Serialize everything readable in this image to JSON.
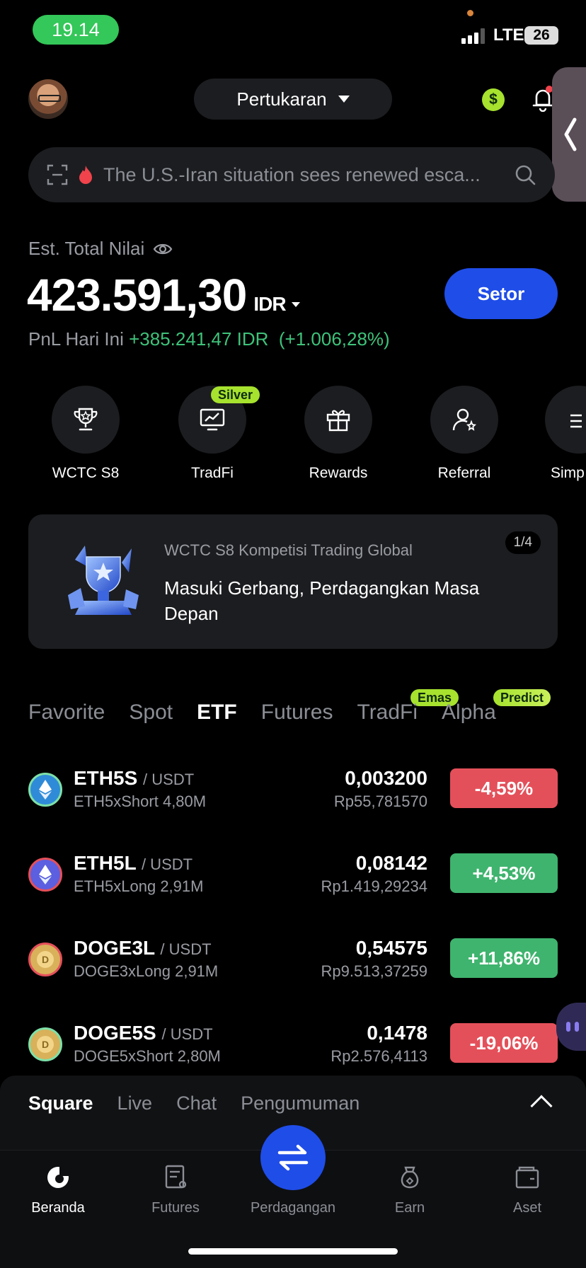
{
  "status": {
    "time": "19.14",
    "network": "LTE",
    "battery": "26"
  },
  "header": {
    "exchange_label": "Pertukaran"
  },
  "search": {
    "placeholder": "The U.S.-Iran situation sees renewed esca..."
  },
  "balance": {
    "label": "Est. Total Nilai",
    "value": "423.591,30",
    "currency": "IDR",
    "deposit_label": "Setor",
    "pnl_label": "PnL Hari Ini",
    "pnl_value": "+385.241,47 IDR",
    "pnl_pct": "(+1.006,28%)"
  },
  "quick_actions": [
    {
      "label": "WCTC S8",
      "icon": "trophy-icon"
    },
    {
      "label": "TradFi",
      "icon": "chart-screen-icon",
      "badge": "Silver"
    },
    {
      "label": "Rewards",
      "icon": "gift-icon"
    },
    {
      "label": "Referral",
      "icon": "user-plus-icon"
    },
    {
      "label": "Simp",
      "icon": "simple-earn-icon"
    }
  ],
  "banner": {
    "subtitle": "WCTC S8 Kompetisi Trading Global",
    "title": "Masuki Gerbang, Perdagangkan Masa Depan",
    "pager": "1/4"
  },
  "market_tabs": [
    {
      "label": "Favorite"
    },
    {
      "label": "Spot"
    },
    {
      "label": "ETF",
      "active": true
    },
    {
      "label": "Futures"
    },
    {
      "label": "TradFi",
      "badge": "Emas"
    },
    {
      "label": "Alpha",
      "badge": "Predict"
    }
  ],
  "markets": [
    {
      "symbol": "ETH5S",
      "pair": "/ USDT",
      "name": "ETH5xShort",
      "volume": "4,80M",
      "price": "0,003200",
      "fiat": "Rp55,781570",
      "change": "-4,59%",
      "dir": "neg",
      "coin_tag": "5S",
      "coin_color": "#2f8bd8",
      "ring": "#7ee0a8"
    },
    {
      "symbol": "ETH5L",
      "pair": "/ USDT",
      "name": "ETH5xLong",
      "volume": "2,91M",
      "price": "0,08142",
      "fiat": "Rp1.419,29234",
      "change": "+4,53%",
      "dir": "pos",
      "coin_tag": "5L",
      "coin_color": "#5b5fe0",
      "ring": "#e4505a"
    },
    {
      "symbol": "DOGE3L",
      "pair": "/ USDT",
      "name": "DOGE3xLong",
      "volume": "2,91M",
      "price": "0,54575",
      "fiat": "Rp9.513,37259",
      "change": "+11,86%",
      "dir": "pos",
      "coin_tag": "3L",
      "coin_color": "#d8b15a",
      "ring": "#e4505a"
    },
    {
      "symbol": "DOGE5S",
      "pair": "/ USDT",
      "name": "DOGE5xShort",
      "volume": "2,80M",
      "price": "0,1478",
      "fiat": "Rp2.576,4113",
      "change": "-19,06%",
      "dir": "neg",
      "coin_tag": "5S",
      "coin_color": "#d8b15a",
      "ring": "#7ee0a8"
    }
  ],
  "social_tabs": [
    {
      "label": "Square",
      "active": true
    },
    {
      "label": "Live"
    },
    {
      "label": "Chat"
    },
    {
      "label": "Pengumuman"
    }
  ],
  "bottom_nav": [
    {
      "label": "Beranda",
      "active": true
    },
    {
      "label": "Futures"
    },
    {
      "label": "Perdagangan"
    },
    {
      "label": "Earn"
    },
    {
      "label": "Aset"
    }
  ]
}
